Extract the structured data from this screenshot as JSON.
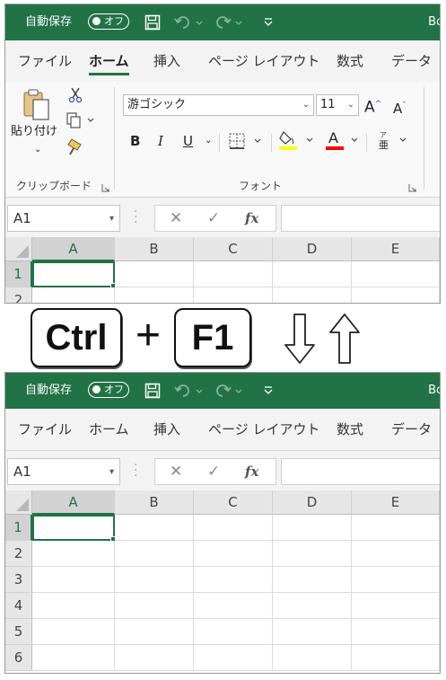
{
  "title_bar": {
    "autosave_label": "自動保存",
    "autosave_state": "オフ",
    "doc_title_partial": "Bo"
  },
  "tabs": [
    {
      "label": "ファイル",
      "active": false
    },
    {
      "label": "ホーム",
      "active": true
    },
    {
      "label": "挿入",
      "active": false
    },
    {
      "label": "ページ レイアウト",
      "active": false
    },
    {
      "label": "数式",
      "active": false
    },
    {
      "label": "データ",
      "active": false
    }
  ],
  "ribbon": {
    "clipboard": {
      "paste_label": "貼り付け",
      "group_label": "クリップボード"
    },
    "font": {
      "font_name": "游ゴシック",
      "font_size": "11",
      "bold": "B",
      "italic": "I",
      "underline": "U",
      "group_label": "フォント"
    }
  },
  "formula_bar": {
    "name_box": "A1",
    "fx_label": "fx",
    "formula_value": ""
  },
  "sheet": {
    "columns": [
      "A",
      "B",
      "C",
      "D",
      "E"
    ],
    "rows_top": [
      "1",
      "2"
    ],
    "rows_bottom": [
      "1",
      "2",
      "3",
      "4",
      "5",
      "6"
    ],
    "active_cell": "A1"
  },
  "shortcut": {
    "key1": "Ctrl",
    "plus": "+",
    "key2": "F1",
    "meaning": "toggle-ribbon"
  },
  "colors": {
    "excel_green": "#217346",
    "highlight_yellow": "#ffff00",
    "font_red": "#ff0000"
  }
}
